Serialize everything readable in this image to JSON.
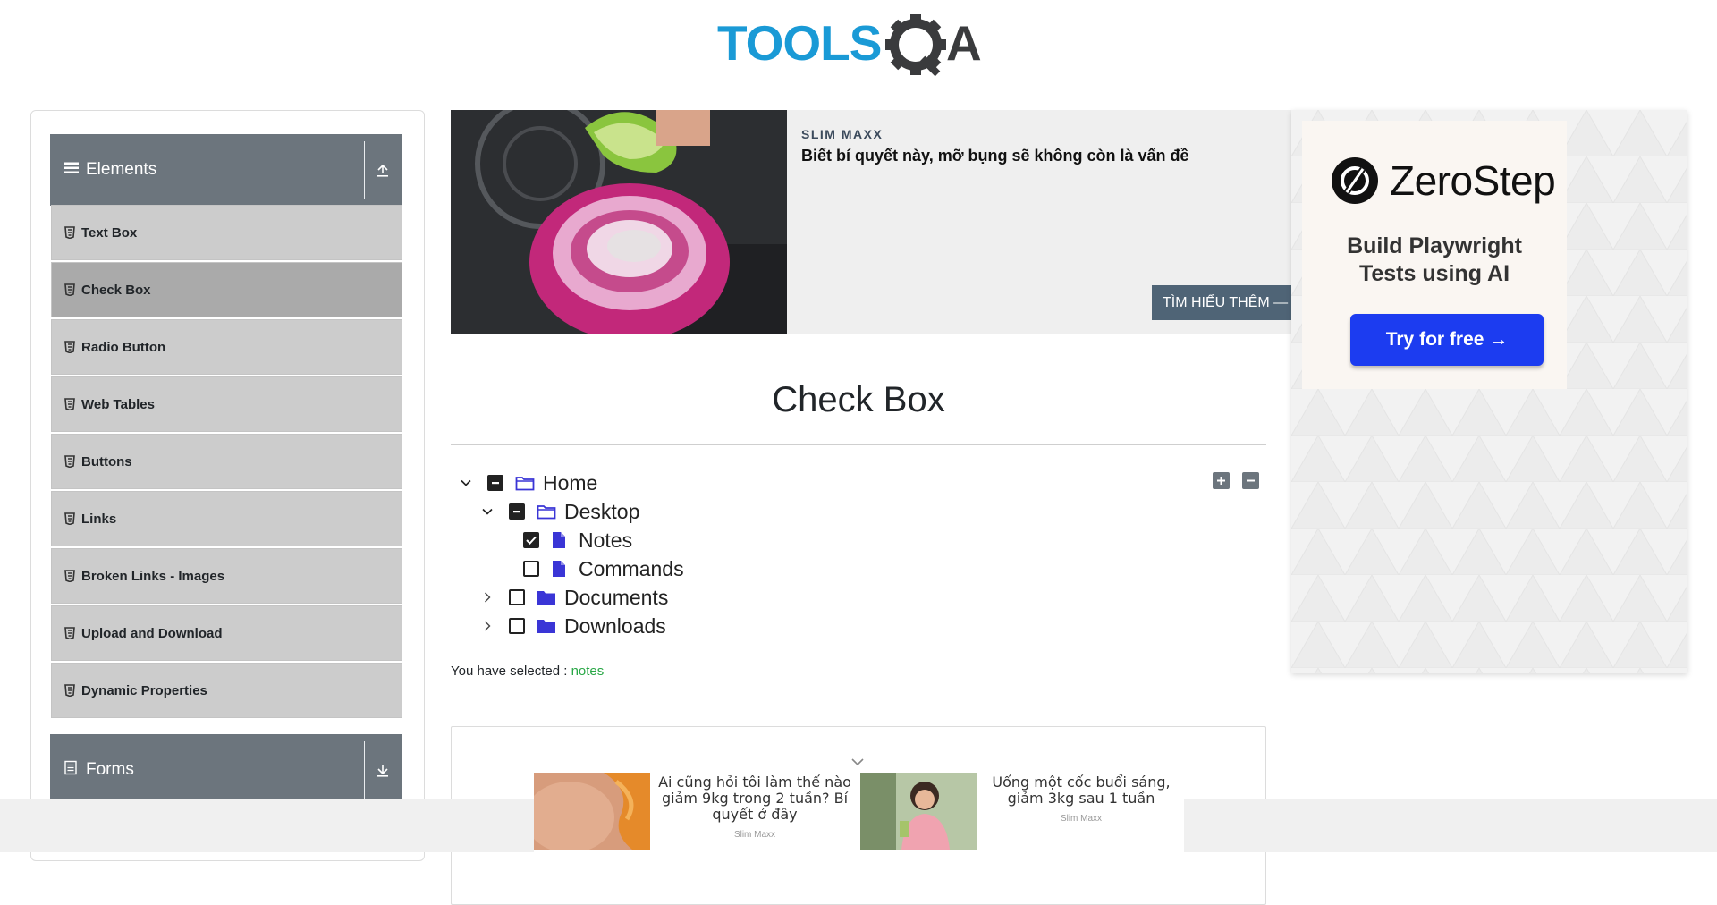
{
  "header": {
    "logo_text": "TOOLSQA",
    "logo_part1": "TOOLS",
    "logo_part2": "A"
  },
  "sidebar": {
    "group_elements": {
      "label": "Elements"
    },
    "items": [
      {
        "label": "Text Box"
      },
      {
        "label": "Check Box",
        "active": true
      },
      {
        "label": "Radio Button"
      },
      {
        "label": "Web Tables"
      },
      {
        "label": "Buttons"
      },
      {
        "label": "Links"
      },
      {
        "label": "Broken Links - Images"
      },
      {
        "label": "Upload and Download"
      },
      {
        "label": "Dynamic Properties"
      }
    ],
    "group_forms": {
      "label": "Forms"
    }
  },
  "top_ad": {
    "brand": "SLIM MAXX",
    "headline": "Biết bí quyết này, mỡ bụng sẽ không còn là vấn đề",
    "cta": "TÌM HIỂU THÊM —"
  },
  "right_ad": {
    "logo": "ZeroStep",
    "tagline": "Build Playwright Tests using AI",
    "button": "Try for free →"
  },
  "main": {
    "title": "Check Box",
    "tree": {
      "home": "Home",
      "desktop": "Desktop",
      "notes": "Notes",
      "commands": "Commands",
      "documents": "Documents",
      "downloads": "Downloads"
    },
    "selected_prefix": "You have selected :",
    "selected_value": "notes"
  },
  "bottom_ad": {
    "item1_text": "Ai cũng hỏi tôi làm thế nào giảm 9kg trong 2 tuần? Bí quyết ở đây",
    "item1_source": "Slim Maxx",
    "item2_text": "Uống một cốc buổi sáng, giảm 3kg sau 1 tuần",
    "item2_source": "Slim Maxx"
  },
  "colors": {
    "accent_blue": "#1a9ad6",
    "logo_dark": "#3a3b3d",
    "sidebar_header": "#6c757d",
    "menu_item": "#cccccc",
    "menu_active": "#aaaaaa",
    "folder_icon": "#3a35d6",
    "selected_green": "#28a745",
    "zerostep_button": "#1c3cf0"
  }
}
